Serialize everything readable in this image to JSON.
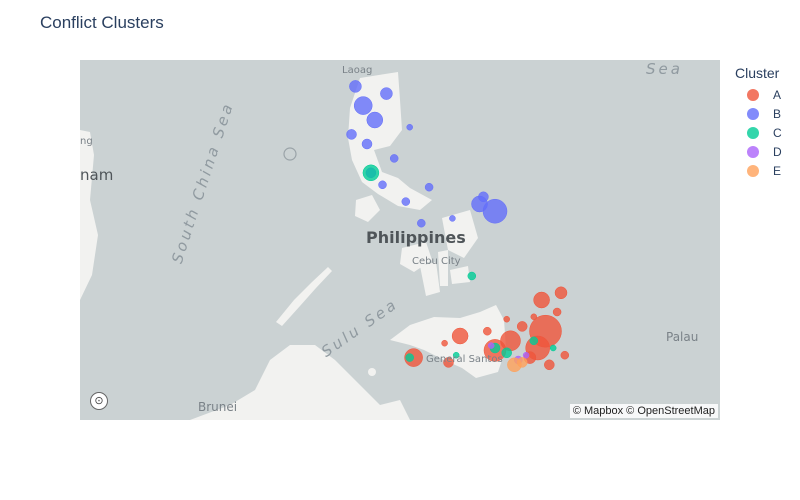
{
  "title": "Conflict Clusters",
  "legend": {
    "title": "Cluster"
  },
  "clusters": [
    {
      "label": "A",
      "color": "#EF553B"
    },
    {
      "label": "B",
      "color": "#636EFA"
    },
    {
      "label": "C",
      "color": "#00CC96"
    },
    {
      "label": "D",
      "color": "#AB63FA"
    },
    {
      "label": "E",
      "color": "#FFA15A"
    }
  ],
  "map_labels": {
    "sea_top": "Sea",
    "south_china_sea": "South China Sea",
    "sulu_sea": "Sulu Sea",
    "philippines": "Philippines",
    "laoag": "Laoag",
    "cebu": "Cebu City",
    "gensan": "General Santos",
    "palau": "Palau",
    "brunei": "Brunei",
    "nam": "nam",
    "ng": "ng"
  },
  "attribution": "© Mapbox © OpenStreetMap",
  "chart_data": {
    "type": "scatter",
    "title": "Conflict Clusters",
    "legend_title": "Cluster",
    "series": [
      {
        "name": "A",
        "points": [
          [
            125.5,
            8.0,
            16
          ],
          [
            125.3,
            7.3,
            12
          ],
          [
            124.2,
            7.2,
            11
          ],
          [
            124.6,
            7.6,
            10
          ],
          [
            122.1,
            6.9,
            9
          ],
          [
            123.3,
            7.8,
            8
          ],
          [
            125.4,
            9.3,
            8
          ],
          [
            125.9,
            9.6,
            6
          ],
          [
            123.0,
            6.7,
            5
          ],
          [
            125.1,
            6.9,
            6
          ],
          [
            124.9,
            8.2,
            5
          ],
          [
            125.8,
            8.8,
            4
          ],
          [
            124.0,
            8.0,
            4
          ],
          [
            126.0,
            7.0,
            4
          ],
          [
            125.6,
            6.6,
            5
          ],
          [
            124.5,
            8.5,
            3
          ],
          [
            122.9,
            7.5,
            3
          ],
          [
            125.2,
            8.6,
            3
          ]
        ]
      },
      {
        "name": "B",
        "points": [
          [
            120.8,
            17.4,
            9
          ],
          [
            121.1,
            16.8,
            8
          ],
          [
            120.6,
            18.2,
            6
          ],
          [
            121.4,
            17.9,
            6
          ],
          [
            120.9,
            15.8,
            5
          ],
          [
            121.0,
            14.6,
            5
          ],
          [
            121.6,
            15.2,
            4
          ],
          [
            122.5,
            14.0,
            4
          ],
          [
            123.9,
            13.6,
            5
          ],
          [
            124.2,
            13.0,
            12
          ],
          [
            123.8,
            13.3,
            8
          ],
          [
            121.9,
            13.4,
            4
          ],
          [
            122.3,
            12.5,
            4
          ],
          [
            120.5,
            16.2,
            5
          ],
          [
            121.3,
            14.1,
            4
          ],
          [
            122.0,
            16.5,
            3
          ],
          [
            123.1,
            12.7,
            3
          ]
        ]
      },
      {
        "name": "C",
        "points": [
          [
            121.0,
            14.6,
            8
          ],
          [
            124.2,
            7.3,
            5
          ],
          [
            124.5,
            7.1,
            5
          ],
          [
            123.6,
            10.3,
            4
          ],
          [
            122.0,
            6.9,
            4
          ],
          [
            125.2,
            7.6,
            4
          ],
          [
            123.2,
            7.0,
            3
          ],
          [
            125.7,
            7.3,
            3
          ]
        ]
      },
      {
        "name": "D",
        "points": [
          [
            124.8,
            6.8,
            4
          ],
          [
            124.1,
            7.4,
            3
          ],
          [
            125.0,
            7.0,
            3
          ]
        ]
      },
      {
        "name": "E",
        "points": [
          [
            124.7,
            6.6,
            7
          ],
          [
            124.9,
            6.7,
            5
          ]
        ]
      }
    ]
  }
}
